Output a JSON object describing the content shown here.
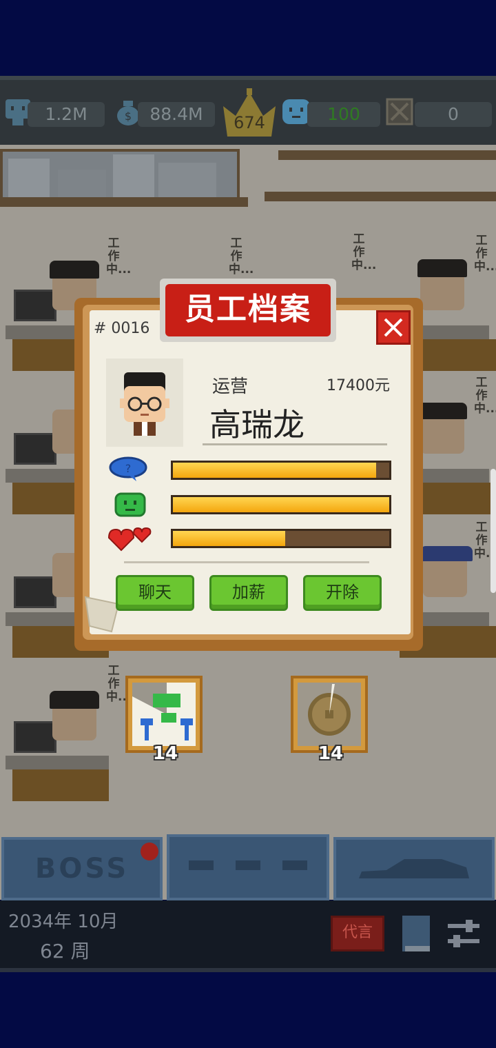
{
  "stats": {
    "employees": "1.2M",
    "money": "88.4M",
    "rank": "674",
    "happiness": "100",
    "blocked": "0"
  },
  "scene": {
    "working_label": "工作中..."
  },
  "dialog": {
    "title": "员工档案",
    "employee_id": "# 0016",
    "role": "运营",
    "salary": "17400元",
    "name": "高瑞龙",
    "bars": [
      {
        "icon": "speech-bubble-icon",
        "fill_percent": 94
      },
      {
        "icon": "mood-face-icon",
        "fill_percent": 100
      },
      {
        "icon": "hearts-icon",
        "fill_percent": 52
      }
    ],
    "buttons": {
      "chat": "聊天",
      "raise": "加薪",
      "fire": "开除"
    }
  },
  "skills": [
    {
      "icon": "network-icon",
      "count": "14"
    },
    {
      "icon": "coin-icon",
      "count": "14"
    }
  ],
  "toolbar": {
    "boss_label": "BOSS",
    "badge_label": "代言"
  },
  "footer": {
    "date": "2034年 10月",
    "week": "62 周"
  },
  "colors": {
    "accent_red": "#c81f16",
    "button_green": "#6bc631",
    "bar_yellow": "#f4a60e",
    "navy_bg": "#030a44"
  }
}
